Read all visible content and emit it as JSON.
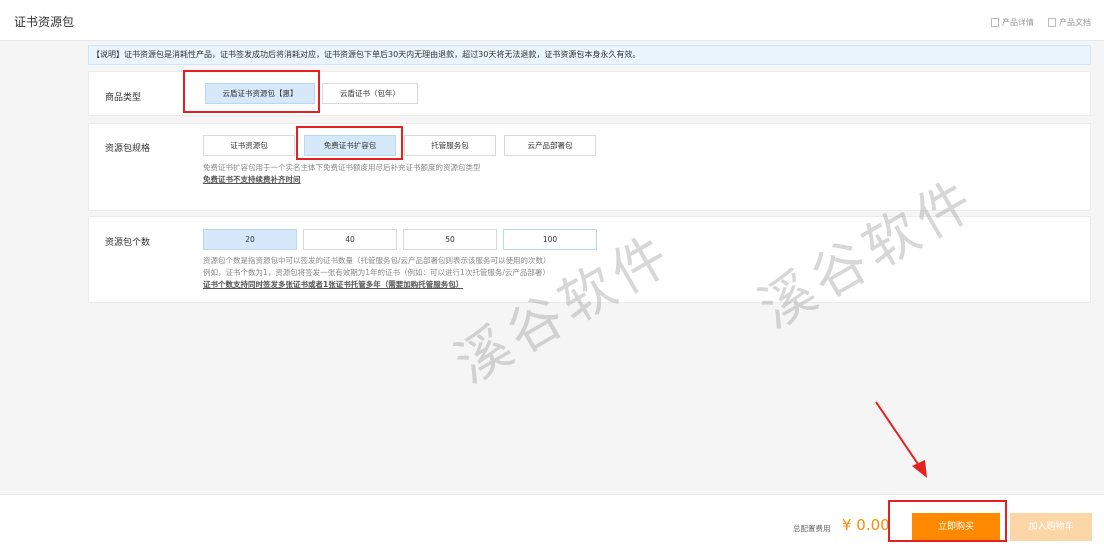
{
  "header": {
    "title": "证书资源包",
    "links": [
      {
        "label": "产品详情",
        "icon": "document-icon"
      },
      {
        "label": "产品文档",
        "icon": "book-icon"
      }
    ]
  },
  "notice": "【说明】证书资源包是消耗性产品，证书签发成功后将消耗对应，证书资源包下单后30天内无理由退款，超过30天将无法退款，证书资源包本身永久有效。",
  "product_type": {
    "label": "商品类型",
    "options": [
      "云盾证书资源包【惠】",
      "云盾证书（包年）"
    ],
    "selected": 0
  },
  "spec": {
    "label": "资源包规格",
    "options": [
      "证书资源包",
      "免费证书扩容包",
      "托管服务包",
      "云产品部署包"
    ],
    "selected": 1,
    "help": "免费证书扩容包用于一个实名主体下免费证书额度用尽后补充证书额度的资源包类型",
    "help_link": "免费证书不支持续费补齐时间"
  },
  "count": {
    "label": "资源包个数",
    "options": [
      "20",
      "40",
      "50",
      "100"
    ],
    "selected": 0,
    "help_lines": [
      "资源包个数是指资源包中可以签发的证书数量（托管服务包/云产品部署包则表示该服务可以使用的次数）",
      "例如，证书个数为1，资源包将签发一张有效期为1年的证书（例如：可以进行1次托管服务/云产品部署）"
    ],
    "help_link": "证书个数支持同时签发多张证书或者1张证书托管多年（需要加购托管服务包）"
  },
  "footer": {
    "total_label": "总配置费用",
    "price": "¥ 0.00",
    "buy_label": "立即购买",
    "cart_label": "加入购物车"
  },
  "watermark": "溪谷软件",
  "colors": {
    "accent": "#ff8a00",
    "selected_bg": "#d5e9fb",
    "highlight": "#e62020"
  }
}
